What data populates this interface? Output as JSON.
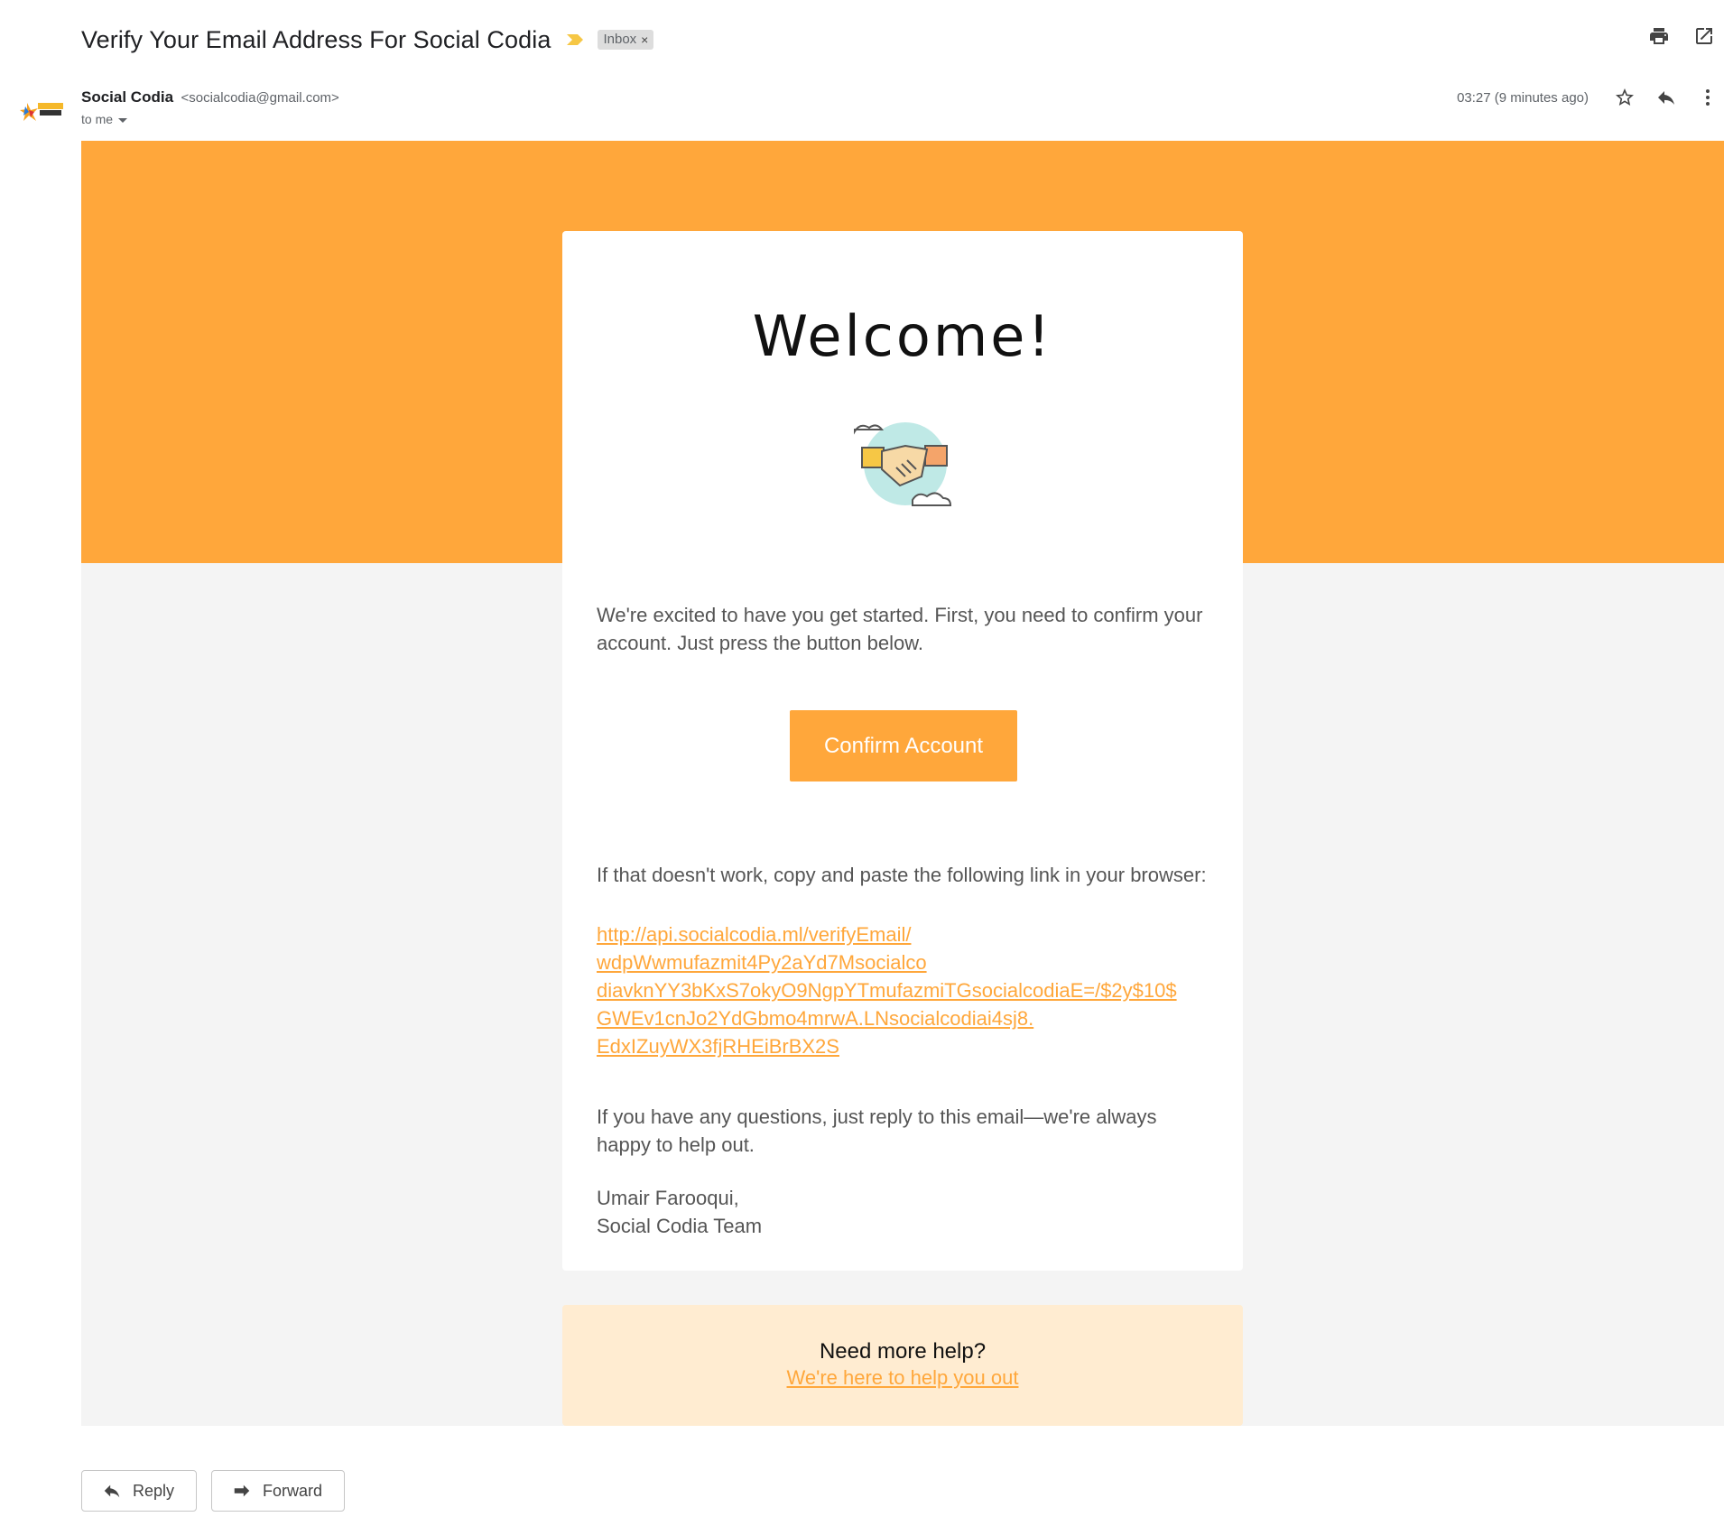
{
  "header": {
    "subject": "Verify Your Email Address For Social Codia",
    "label": "Inbox",
    "label_close": "×"
  },
  "sender": {
    "name": "Social Codia",
    "email": "<socialcodia@gmail.com>",
    "to": "to me",
    "time": "03:27 (9 minutes ago)"
  },
  "email": {
    "welcome": "Welcome!",
    "intro": "We're excited to have you get started. First, you need to confirm your account. Just press the button below.",
    "confirm_label": "Confirm Account",
    "fallback": "If that doesn't work, copy and paste the following link in your browser:",
    "link_line1": "http://api.socialcodia.ml/verifyEmail/",
    "link_line2": "wdpWwmufazmit4Py2aYd7Msocialco",
    "link_line3": "diavknYY3bKxS7okyO9NgpYTmufazmiTGsocialcodiaE=/$2y$10$",
    "link_line4": "GWEv1cnJo2YdGbmo4mrwA.LNsocialcodiai4sj8.",
    "link_line5": "EdxIZuyWX3fjRHEiBrBX2S",
    "questions": "If you have any questions, just reply to this email—we're always happy to help out.",
    "signoff_name": "Umair Farooqui,",
    "signoff_team": "Social Codia Team",
    "help_title": "Need more help?",
    "help_link": "We're here to help you out"
  },
  "actions": {
    "reply": "Reply",
    "forward": "Forward"
  },
  "colors": {
    "brand_orange": "#ffa73b",
    "help_bg": "#ffecd1",
    "body_bg": "#f4f4f4"
  },
  "icons": [
    "print-icon",
    "open-in-new-icon",
    "star-icon",
    "reply-icon",
    "more-vert-icon",
    "importance-marker-icon",
    "handshake-icon",
    "forward-icon",
    "caret-down-icon"
  ]
}
